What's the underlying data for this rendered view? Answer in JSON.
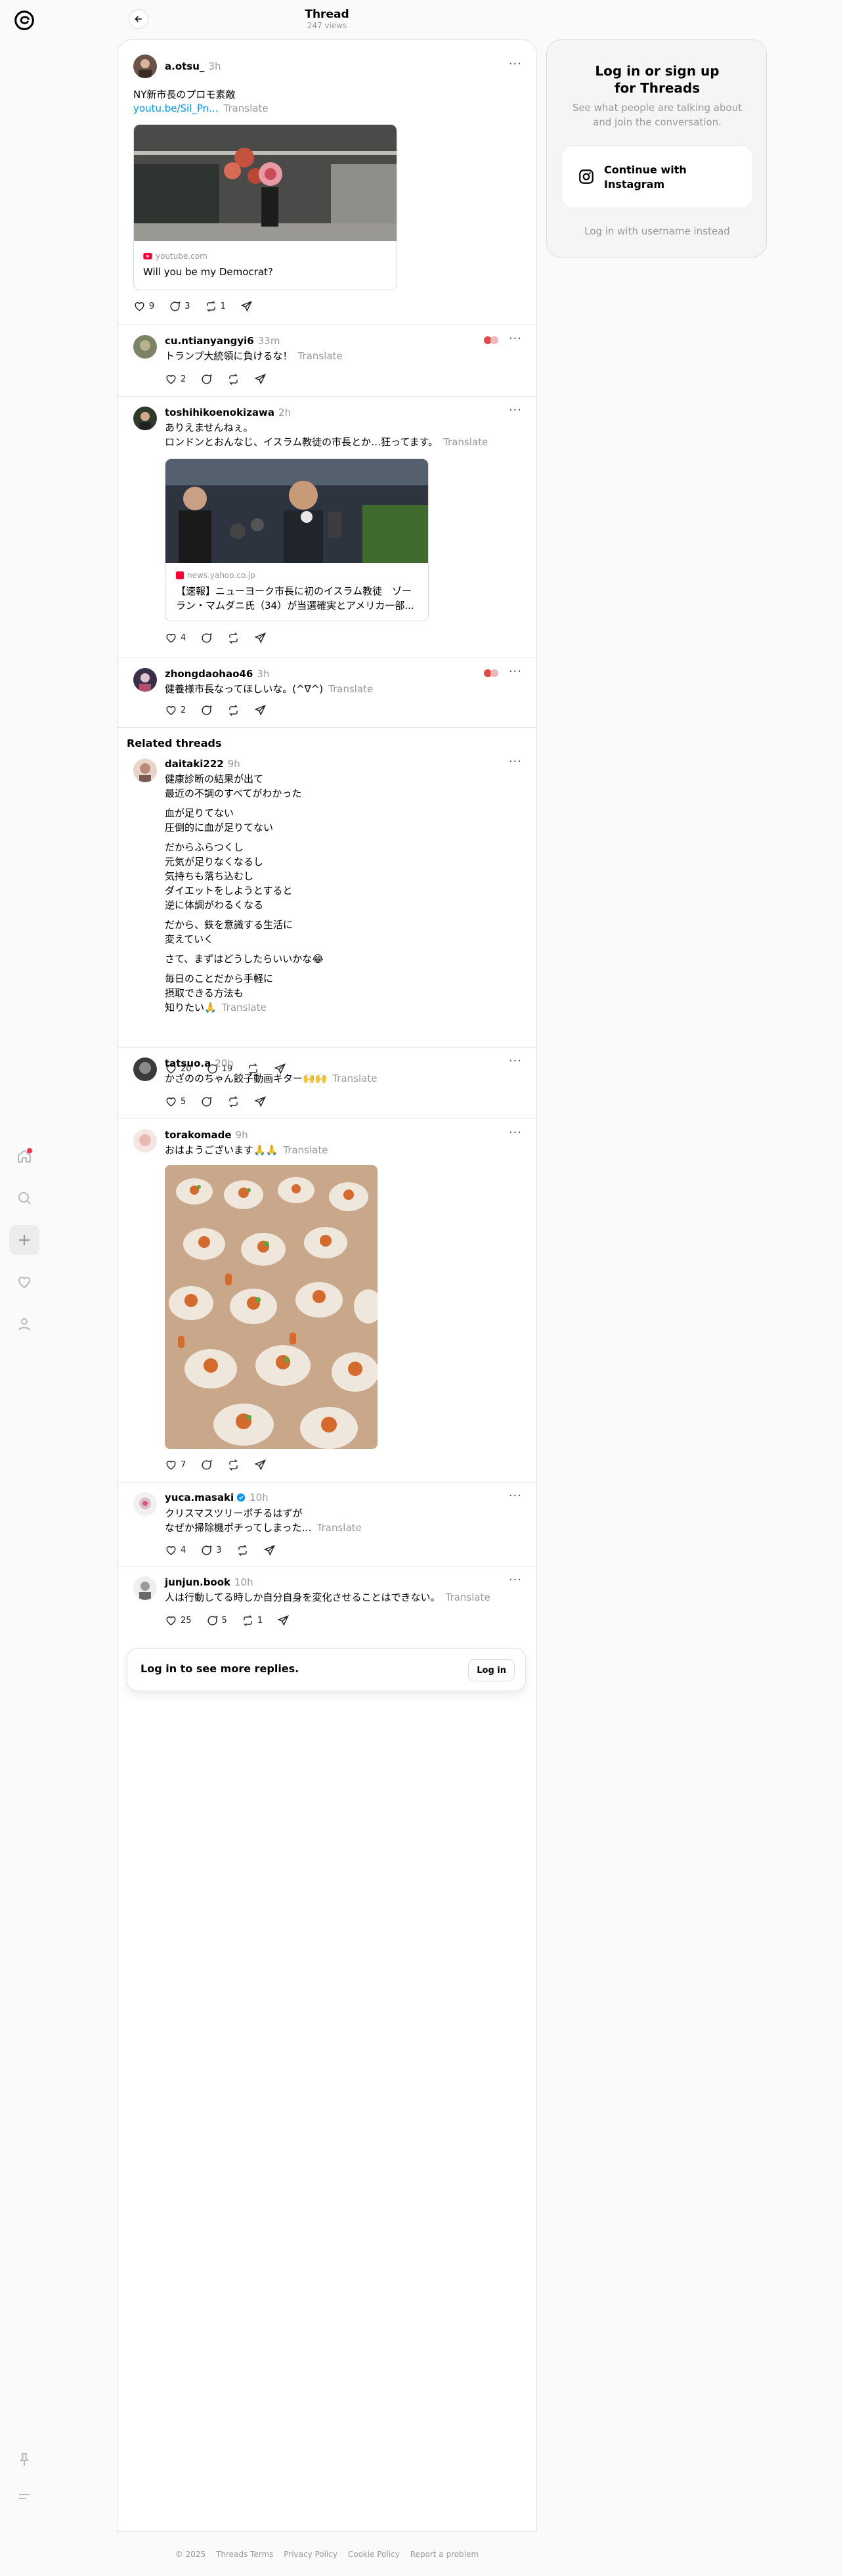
{
  "header": {
    "title": "Thread",
    "views": "247 views"
  },
  "main_post": {
    "username": "a.otsu_",
    "time": "3h",
    "text": "NY新市長のプロモ素敵",
    "link": "youtu.be/Sil_Pn...",
    "translate": "Translate",
    "card": {
      "source": "youtube.com",
      "title": "Will you be my Democrat?"
    },
    "likes": "9",
    "replies": "3",
    "reposts": "1"
  },
  "replies": [
    {
      "username": "cu.ntianyangyi6",
      "time": "33m",
      "text": "トランプ大統領に負けるな！",
      "translate": "Translate",
      "likes": "2"
    },
    {
      "username": "toshihikoenokizawa",
      "time": "2h",
      "line1": "ありえませんねぇ。",
      "line2": "ロンドンとおんなじ、イスラム教徒の市長とか…狂ってます。",
      "translate": "Translate",
      "card": {
        "source": "news.yahoo.co.jp",
        "title": "【速報】ニューヨーク市長に初のイスラム教徒　ゾーラン・マムダニ氏（34）が当選確実とアメリカ一部..."
      },
      "likes": "4"
    },
    {
      "username": "zhongdaohao46",
      "time": "3h",
      "text": "健養様市長なってほしいな。(^∇^)",
      "translate": "Translate",
      "likes": "2"
    }
  ],
  "related": {
    "title": "Related threads",
    "posts": [
      {
        "username": "daitaki222",
        "time": "9h",
        "lines": [
          "健康診断の結果が出て",
          "最近の不調のすべてがわかった",
          "",
          "血が足りてない",
          "圧倒的に血が足りてない",
          "",
          "だからふらつくし",
          "元気が足りなくなるし",
          "気持ちも落ち込むし",
          "ダイエットをしようとすると",
          "逆に体調がわるくなる",
          "",
          "だから、鉄を意識する生活に",
          "変えていく",
          "",
          "さて、まずはどうしたらいいかな😂",
          "",
          "毎日のことだから手軽に",
          "摂取できる方法も",
          "知りたい🙏"
        ],
        "translate": "Translate",
        "likes": "20",
        "replies": "19"
      },
      {
        "username": "tatsuo.a",
        "time": "20h",
        "text": "かざののちゃん餃子動画キター🙌🙌",
        "translate": "Translate",
        "likes": "5"
      },
      {
        "username": "torakomade",
        "time": "9h",
        "text": "おはようございます🙏🙏",
        "translate": "Translate",
        "likes": "7"
      },
      {
        "username": "yuca.masaki",
        "time": "10h",
        "line1": "クリスマスツリーポチるはずが",
        "line2": "なぜか掃除機ポチってしまった…",
        "translate": "Translate",
        "likes": "4",
        "replies": "3"
      },
      {
        "username": "junjun.book",
        "time": "10h",
        "text": "人は行動してる時しか自分自身を変化させることはできない。",
        "translate": "Translate",
        "likes": "25",
        "replies": "5",
        "reposts": "1"
      }
    ]
  },
  "login_bar": {
    "text": "Log in to see more replies.",
    "button": "Log in"
  },
  "side": {
    "title_line1": "Log in or sign up",
    "title_line2": "for Threads",
    "subtitle": "See what people are talking about and join the conversation.",
    "ig_button": "Continue with Instagram",
    "username_link": "Log in with username instead"
  },
  "footer": [
    "© 2025",
    "Threads Terms",
    "Privacy Policy",
    "Cookie Policy",
    "Report a problem"
  ],
  "colors": {
    "link": "#0095f6",
    "muted": "#999999",
    "notification": "#ff3040",
    "verified": "#0095f6",
    "youtube": "#ff0033"
  },
  "icons": [
    "threads-logo-icon",
    "home-icon",
    "search-icon",
    "plus-icon",
    "heart-icon",
    "profile-icon",
    "pin-icon",
    "menu-icon",
    "back-arrow-icon",
    "more-icon",
    "comment-icon",
    "repost-icon",
    "share-icon",
    "instagram-icon",
    "verified-icon"
  ]
}
